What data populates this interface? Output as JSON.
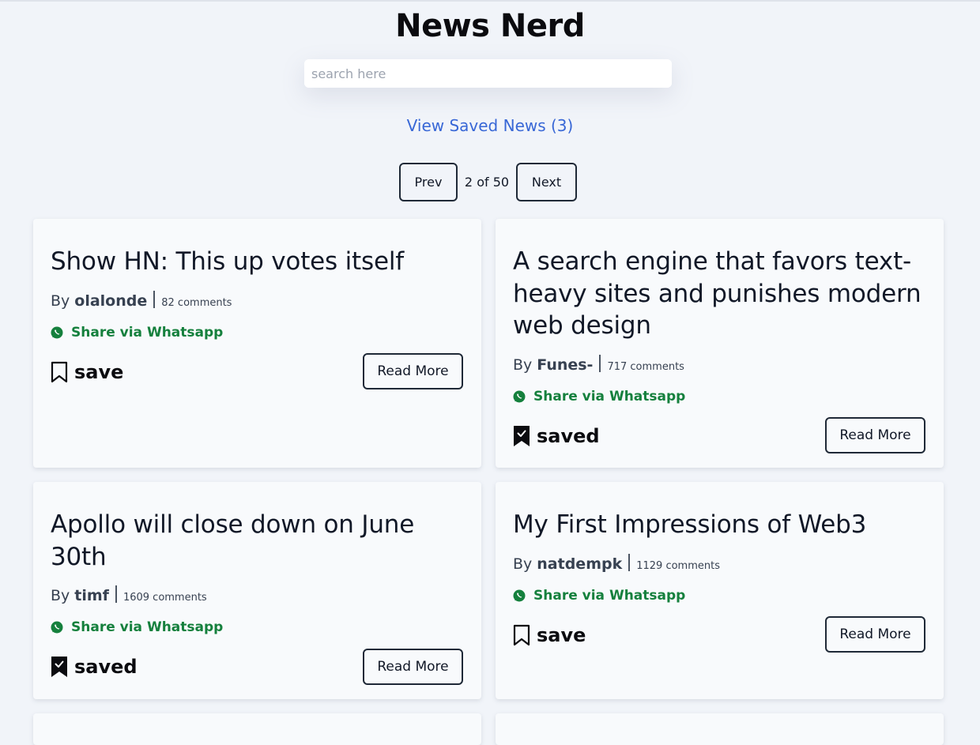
{
  "app": {
    "title": "News Nerd"
  },
  "search": {
    "placeholder": "search here",
    "value": ""
  },
  "saved_link": {
    "label": "View Saved News (3)"
  },
  "pagination": {
    "prev_label": "Prev",
    "info": "2 of 50",
    "next_label": "Next"
  },
  "common": {
    "by_label": "By",
    "share_label": "Share via Whatsapp",
    "read_more_label": "Read More"
  },
  "articles": [
    {
      "title": "Show HN: This up votes itself",
      "author": "olalonde",
      "comments": "82 comments",
      "save_label": "save",
      "saved": false
    },
    {
      "title": "A search engine that favors text-heavy sites and punishes modern web design",
      "author": "Funes-",
      "comments": "717 comments",
      "save_label": "saved",
      "saved": true
    },
    {
      "title": "Apollo will close down on June 30th",
      "author": "timf",
      "comments": "1609 comments",
      "save_label": "saved",
      "saved": true
    },
    {
      "title": "My First Impressions of Web3",
      "author": "natdempk",
      "comments": "1129 comments",
      "save_label": "save",
      "saved": false
    }
  ],
  "colors": {
    "link": "#3867d6",
    "share": "#15803d",
    "background": "#f1f4f9",
    "card": "#f8fafc"
  }
}
